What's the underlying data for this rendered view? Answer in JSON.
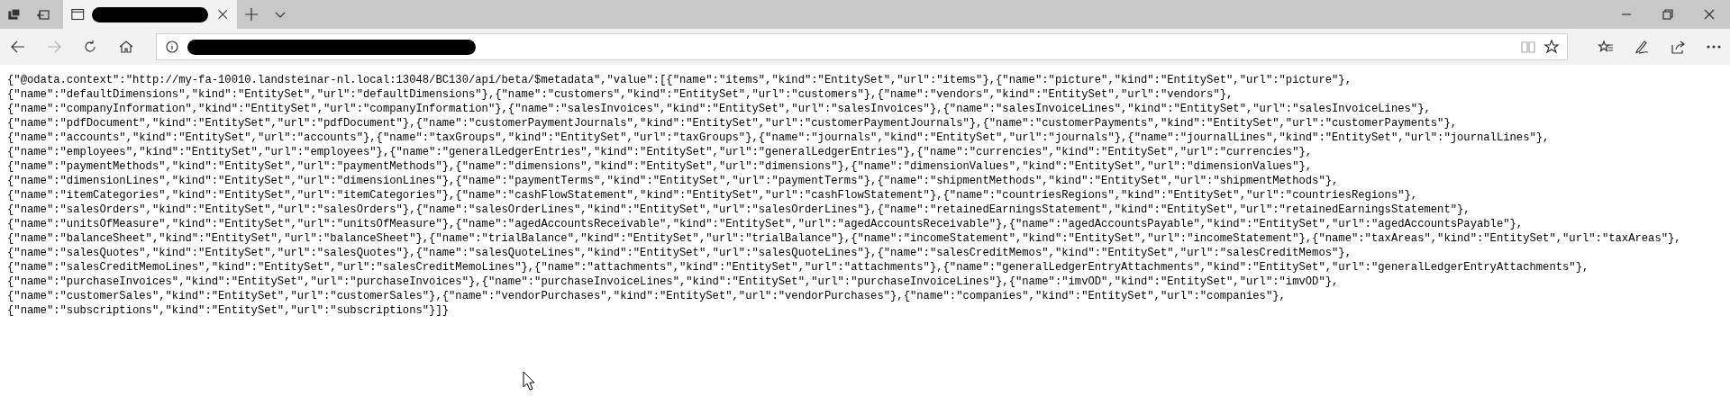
{
  "toolbar": {
    "forward_disabled": true
  },
  "lines": [
    "{\"@odata.context\":\"http://my-fa-10010.landsteinar-nl.local:13048/BC130/api/beta/$metadata\",\"value\":[{\"name\":\"items\",\"kind\":\"EntitySet\",\"url\":\"items\"},{\"name\":\"picture\",\"kind\":\"EntitySet\",\"url\":\"picture\"},",
    "{\"name\":\"defaultDimensions\",\"kind\":\"EntitySet\",\"url\":\"defaultDimensions\"},{\"name\":\"customers\",\"kind\":\"EntitySet\",\"url\":\"customers\"},{\"name\":\"vendors\",\"kind\":\"EntitySet\",\"url\":\"vendors\"},",
    "{\"name\":\"companyInformation\",\"kind\":\"EntitySet\",\"url\":\"companyInformation\"},{\"name\":\"salesInvoices\",\"kind\":\"EntitySet\",\"url\":\"salesInvoices\"},{\"name\":\"salesInvoiceLines\",\"kind\":\"EntitySet\",\"url\":\"salesInvoiceLines\"},",
    "{\"name\":\"pdfDocument\",\"kind\":\"EntitySet\",\"url\":\"pdfDocument\"},{\"name\":\"customerPaymentJournals\",\"kind\":\"EntitySet\",\"url\":\"customerPaymentJournals\"},{\"name\":\"customerPayments\",\"kind\":\"EntitySet\",\"url\":\"customerPayments\"},",
    "{\"name\":\"accounts\",\"kind\":\"EntitySet\",\"url\":\"accounts\"},{\"name\":\"taxGroups\",\"kind\":\"EntitySet\",\"url\":\"taxGroups\"},{\"name\":\"journals\",\"kind\":\"EntitySet\",\"url\":\"journals\"},{\"name\":\"journalLines\",\"kind\":\"EntitySet\",\"url\":\"journalLines\"},",
    "{\"name\":\"employees\",\"kind\":\"EntitySet\",\"url\":\"employees\"},{\"name\":\"generalLedgerEntries\",\"kind\":\"EntitySet\",\"url\":\"generalLedgerEntries\"},{\"name\":\"currencies\",\"kind\":\"EntitySet\",\"url\":\"currencies\"},",
    "{\"name\":\"paymentMethods\",\"kind\":\"EntitySet\",\"url\":\"paymentMethods\"},{\"name\":\"dimensions\",\"kind\":\"EntitySet\",\"url\":\"dimensions\"},{\"name\":\"dimensionValues\",\"kind\":\"EntitySet\",\"url\":\"dimensionValues\"},",
    "{\"name\":\"dimensionLines\",\"kind\":\"EntitySet\",\"url\":\"dimensionLines\"},{\"name\":\"paymentTerms\",\"kind\":\"EntitySet\",\"url\":\"paymentTerms\"},{\"name\":\"shipmentMethods\",\"kind\":\"EntitySet\",\"url\":\"shipmentMethods\"},",
    "{\"name\":\"itemCategories\",\"kind\":\"EntitySet\",\"url\":\"itemCategories\"},{\"name\":\"cashFlowStatement\",\"kind\":\"EntitySet\",\"url\":\"cashFlowStatement\"},{\"name\":\"countriesRegions\",\"kind\":\"EntitySet\",\"url\":\"countriesRegions\"},",
    "{\"name\":\"salesOrders\",\"kind\":\"EntitySet\",\"url\":\"salesOrders\"},{\"name\":\"salesOrderLines\",\"kind\":\"EntitySet\",\"url\":\"salesOrderLines\"},{\"name\":\"retainedEarningsStatement\",\"kind\":\"EntitySet\",\"url\":\"retainedEarningsStatement\"},",
    "{\"name\":\"unitsOfMeasure\",\"kind\":\"EntitySet\",\"url\":\"unitsOfMeasure\"},{\"name\":\"agedAccountsReceivable\",\"kind\":\"EntitySet\",\"url\":\"agedAccountsReceivable\"},{\"name\":\"agedAccountsPayable\",\"kind\":\"EntitySet\",\"url\":\"agedAccountsPayable\"},",
    "{\"name\":\"balanceSheet\",\"kind\":\"EntitySet\",\"url\":\"balanceSheet\"},{\"name\":\"trialBalance\",\"kind\":\"EntitySet\",\"url\":\"trialBalance\"},{\"name\":\"incomeStatement\",\"kind\":\"EntitySet\",\"url\":\"incomeStatement\"},{\"name\":\"taxAreas\",\"kind\":\"EntitySet\",\"url\":\"taxAreas\"},",
    "{\"name\":\"salesQuotes\",\"kind\":\"EntitySet\",\"url\":\"salesQuotes\"},{\"name\":\"salesQuoteLines\",\"kind\":\"EntitySet\",\"url\":\"salesQuoteLines\"},{\"name\":\"salesCreditMemos\",\"kind\":\"EntitySet\",\"url\":\"salesCreditMemos\"},",
    "{\"name\":\"salesCreditMemoLines\",\"kind\":\"EntitySet\",\"url\":\"salesCreditMemoLines\"},{\"name\":\"attachments\",\"kind\":\"EntitySet\",\"url\":\"attachments\"},{\"name\":\"generalLedgerEntryAttachments\",\"kind\":\"EntitySet\",\"url\":\"generalLedgerEntryAttachments\"},",
    "{\"name\":\"purchaseInvoices\",\"kind\":\"EntitySet\",\"url\":\"purchaseInvoices\"},{\"name\":\"purchaseInvoiceLines\",\"kind\":\"EntitySet\",\"url\":\"purchaseInvoiceLines\"},{\"name\":\"imvOD\",\"kind\":\"EntitySet\",\"url\":\"imvOD\"},",
    "{\"name\":\"customerSales\",\"kind\":\"EntitySet\",\"url\":\"customerSales\"},{\"name\":\"vendorPurchases\",\"kind\":\"EntitySet\",\"url\":\"vendorPurchases\"},{\"name\":\"companies\",\"kind\":\"EntitySet\",\"url\":\"companies\"},",
    "{\"name\":\"subscriptions\",\"kind\":\"EntitySet\",\"url\":\"subscriptions\"}]}"
  ]
}
